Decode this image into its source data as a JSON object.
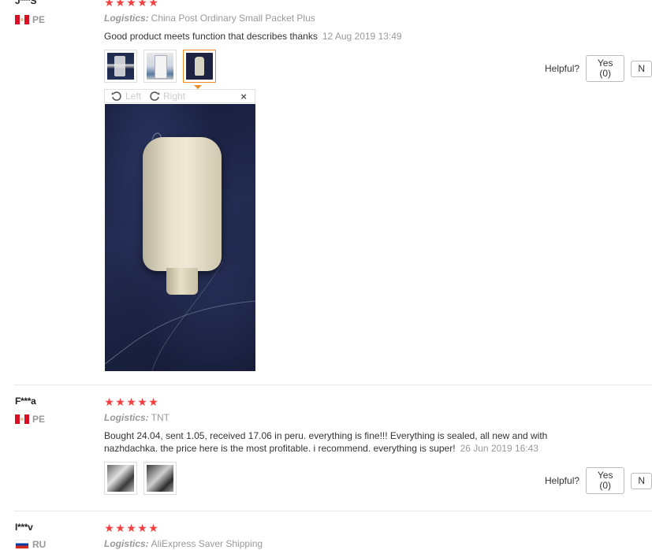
{
  "reviews": [
    {
      "user": "J***S",
      "country": "PE",
      "stars": 5,
      "logistics_label": "Logistics:",
      "logistics_value": "China Post Ordinary Small Packet Plus",
      "feedback": "Good product meets function that describes thanks",
      "date": "12 Aug 2019 13:49",
      "helpful_label": "Helpful?",
      "yes_label": "Yes (0)",
      "no_label": "N",
      "thumb_icons": [
        "product-photo-1",
        "product-photo-2",
        "product-photo-3"
      ]
    },
    {
      "user": "F***a",
      "country": "PE",
      "stars": 5,
      "logistics_label": "Logistics:",
      "logistics_value": "TNT",
      "feedback_line1": "Bought 24.04, sent 1.05, received 17.06 in peru. everything is fine!!! Everything is sealed, all new and with",
      "feedback_line2": "nazhdachka. the price here is the most profitable. i recommend. everything is super!",
      "date": "26 Jun 2019 16:43",
      "helpful_label": "Helpful?",
      "yes_label": "Yes (0)",
      "no_label": "N",
      "thumb_icons": [
        "product-photo-1",
        "product-photo-2"
      ]
    },
    {
      "user": "I***v",
      "country": "RU",
      "stars": 5,
      "logistics_label": "Logistics:",
      "logistics_value": "AliExpress Saver Shipping"
    }
  ],
  "viewer": {
    "rotate_left": "Left",
    "rotate_right": "Right",
    "close": "×"
  },
  "colors": {
    "star": "#f04040",
    "active_thumb": "#f08a24",
    "muted_text": "#999999"
  }
}
